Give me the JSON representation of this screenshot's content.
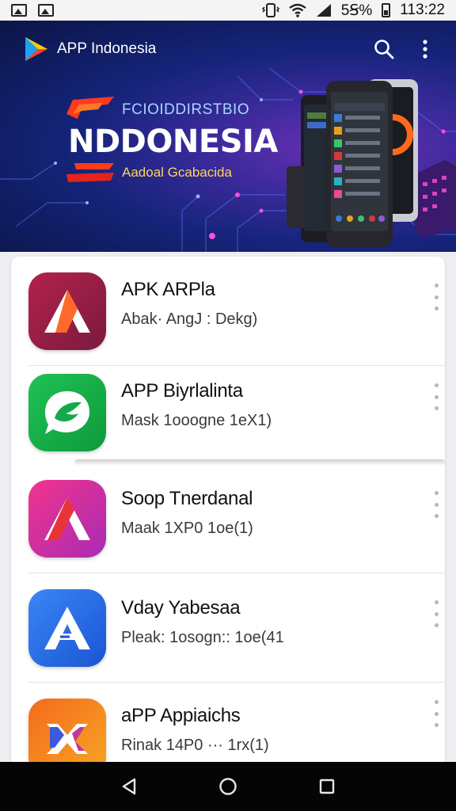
{
  "status_bar": {
    "battery": "5Ꞩ%",
    "time": "113:22"
  },
  "app_bar": {
    "title": "APP Indonesia",
    "icons": [
      "app-logo-icon",
      "search-icon",
      "more-vert-icon"
    ]
  },
  "banner": {
    "kicker": "FCIOIDDIRSTBIO",
    "headline": "NDDONESIA",
    "subtitle": "Aadoal Gcabacida"
  },
  "apps": [
    {
      "title": "APK ARPla",
      "subtitle": "Abak· AngJ : Dekg)",
      "icon": "letter-a-icon",
      "color": "#9c1f45",
      "color2": "#c6243a"
    },
    {
      "title": "APP Biyrlalinta",
      "subtitle": "Mask 1ooogne 1eX1)",
      "icon": "leaf-chat-icon",
      "color": "#17b24a",
      "color2": "#0fa63c"
    },
    {
      "title": "Soop Tnerdanal",
      "subtitle": "Maak 1XP0 1oe(1)",
      "icon": "letter-a-icon",
      "color": "#e2358e",
      "color2": "#b12aa8"
    },
    {
      "title": "Vday Yabesaa",
      "subtitle": "Pleak: 1osogn:: 1oe(41",
      "icon": "letter-a-icon",
      "color": "#2f7cf0",
      "color2": "#1d58d6"
    },
    {
      "title": "aPP Appiaichs",
      "subtitle": "Rinak 14P0 ··· 1rx(1)",
      "icon": "cross-ribbon-icon",
      "color": "#f77b1c",
      "color2": "#f4a321"
    }
  ],
  "nav": {
    "icons": [
      "back-triangle-icon",
      "home-circle-icon",
      "recents-square-icon"
    ]
  }
}
